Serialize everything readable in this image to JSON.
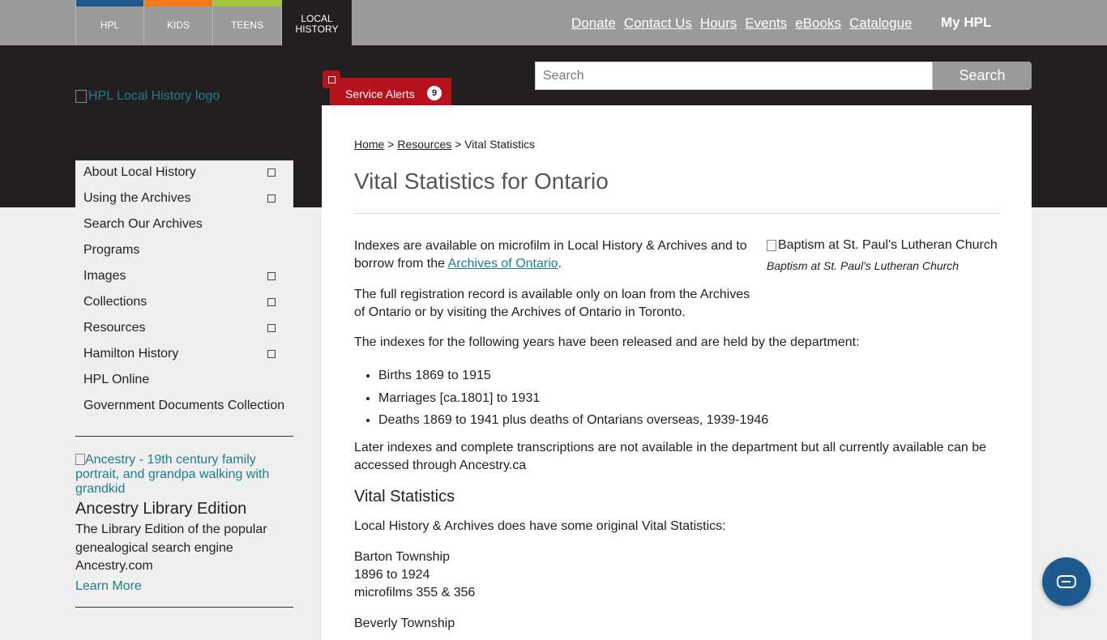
{
  "topnav": {
    "tabs": [
      {
        "label": "HPL",
        "color": "#1d5a8e"
      },
      {
        "label": "KIDS",
        "color": "#f47a20"
      },
      {
        "label": "TEENS",
        "color": "#a3c73c"
      },
      {
        "label": "LOCAL\nHISTORY",
        "color": "#231f20"
      }
    ],
    "links": [
      "Donate",
      "Contact Us",
      "Hours",
      "Events",
      "eBooks",
      "Catalogue"
    ],
    "my_hpl": "My HPL"
  },
  "header": {
    "logo_alt": "HPL Local History logo",
    "service_alerts": {
      "label": "Service Alerts",
      "count": "9"
    },
    "search": {
      "placeholder": "Search",
      "button": "Search"
    }
  },
  "sidebar": {
    "items": [
      {
        "label": "About Local History",
        "expandable": true
      },
      {
        "label": "Using the Archives",
        "expandable": true
      },
      {
        "label": "Search Our Archives",
        "expandable": false
      },
      {
        "label": "Programs",
        "expandable": false
      },
      {
        "label": "Images",
        "expandable": true
      },
      {
        "label": "Collections",
        "expandable": true
      },
      {
        "label": "Resources",
        "expandable": true
      },
      {
        "label": "Hamilton History",
        "expandable": true
      },
      {
        "label": "HPL Online",
        "expandable": false
      },
      {
        "label": "Government Documents Collection",
        "expandable": false
      }
    ],
    "promo": {
      "image_alt": "Ancestry - 19th century family portrait, and grandpa walking with grandkid",
      "title": "Ancestry Library Edition",
      "text": "The Library Edition of the popular genealogical search engine Ancestry.com",
      "link": "Learn More"
    }
  },
  "main": {
    "breadcrumb": {
      "home": "Home",
      "sep1": " > ",
      "resources": "Resources",
      "sep2": " > ",
      "current": "Vital Statistics"
    },
    "title": "Vital Statistics for Ontario",
    "figure": {
      "alt": "Baptism at St. Paul's Lutheran Church",
      "caption": "Baptism at St. Paul’s Lutheran Church"
    },
    "p1_pre": "Indexes are available on microfilm in Local History & Archives and to borrow from the ",
    "p1_link": "Archives of Ontario",
    "p1_post": ".",
    "p2": "The full registration record is available only on loan from the Archives of Ontario or by visiting the Archives of Ontario in Toronto.",
    "p3": "The indexes for the following years have been released and are held by the department:",
    "list": [
      "Births 1869 to 1915",
      "Marriages [ca.1801] to 1931",
      "Deaths 1869 to 1941 plus deaths of Ontarians overseas, 1939-1946"
    ],
    "p4": "Later indexes and complete transcriptions are not available in the department but all currently available can be accessed through Ancestry.ca",
    "subheading": "Vital Statistics",
    "p5": "Local History & Archives does have some original Vital Statistics:",
    "record1": [
      "Barton Township",
      "1896 to 1924",
      "microfilms 355 & 356"
    ],
    "record2_partial": "Beverly Township"
  },
  "colors": {
    "accent_link": "#1e7e8c",
    "alert_red": "#b5121b",
    "dark_band": "#231f20",
    "chat": "#1d5a8e"
  }
}
